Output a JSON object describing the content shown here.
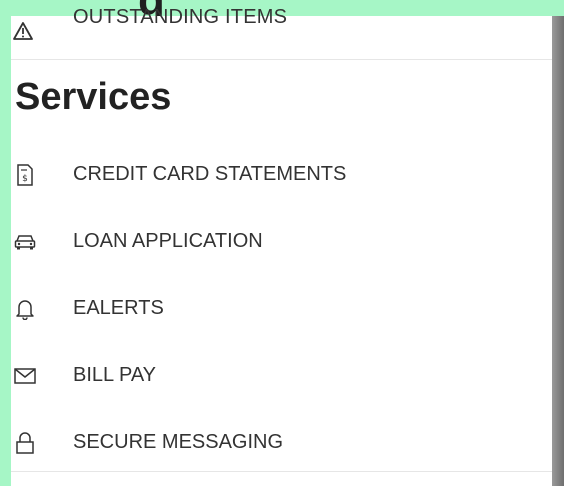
{
  "header_overlay": {
    "partial_text": "g"
  },
  "outstanding": {
    "label": "OUTSTANDING ITEMS",
    "icon": "warning-icon"
  },
  "services": {
    "title": "Services",
    "items": [
      {
        "label": "CREDIT CARD STATEMENTS",
        "icon": "statement-icon"
      },
      {
        "label": "LOAN APPLICATION",
        "icon": "car-icon"
      },
      {
        "label": "EALERTS",
        "icon": "bell-icon"
      },
      {
        "label": "BILL PAY",
        "icon": "envelope-icon"
      },
      {
        "label": "SECURE MESSAGING",
        "icon": "lock-icon"
      }
    ]
  },
  "colors": {
    "background": "#a6f6c6",
    "panel": "#ffffff",
    "text": "#333333"
  }
}
